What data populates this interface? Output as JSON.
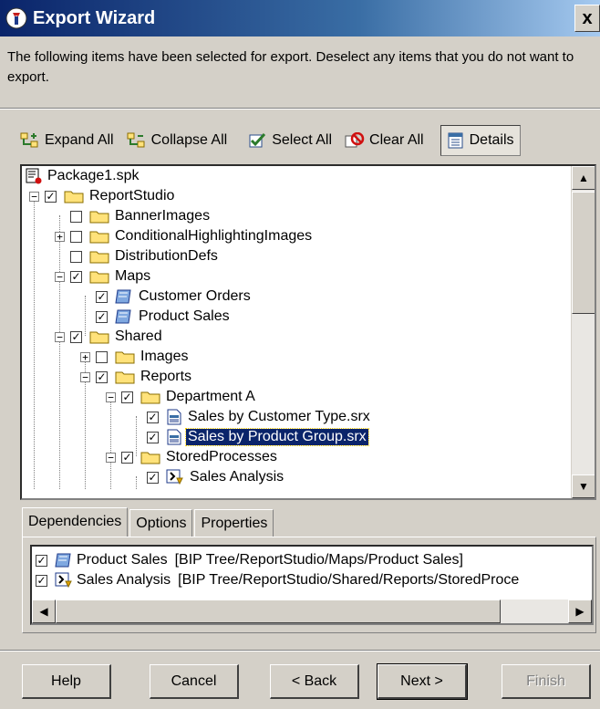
{
  "window": {
    "title": "Export Wizard",
    "close_label": "x"
  },
  "intro_text": "The following items have been selected for export.  Deselect any items that you do not want to export.",
  "toolbar": {
    "expand_all": "Expand All",
    "collapse_all": "Collapse All",
    "select_all": "Select All",
    "clear_all": "Clear All",
    "details": "Details"
  },
  "tree": {
    "root": "Package1.spk",
    "items": [
      {
        "label": "ReportStudio",
        "checked": true
      },
      {
        "label": "BannerImages",
        "checked": false
      },
      {
        "label": "ConditionalHighlightingImages",
        "checked": false
      },
      {
        "label": "DistributionDefs",
        "checked": false
      },
      {
        "label": "Maps",
        "checked": true
      },
      {
        "label": "Customer Orders",
        "checked": true
      },
      {
        "label": "Product Sales",
        "checked": true
      },
      {
        "label": "Shared",
        "checked": true
      },
      {
        "label": "Images",
        "checked": false
      },
      {
        "label": "Reports",
        "checked": true
      },
      {
        "label": "Department A",
        "checked": true
      },
      {
        "label": "Sales by Customer Type.srx",
        "checked": true
      },
      {
        "label": "Sales by Product Group.srx",
        "checked": true,
        "selected": true
      },
      {
        "label": "StoredProcesses",
        "checked": true
      },
      {
        "label": "Sales Analysis",
        "checked": true
      }
    ]
  },
  "tabs": [
    "Dependencies",
    "Options",
    "Properties"
  ],
  "dependencies": [
    {
      "name": "Product Sales",
      "path": "[BIP Tree/ReportStudio/Maps/Product Sales]",
      "checked": true
    },
    {
      "name": "Sales Analysis",
      "path": "[BIP Tree/ReportStudio/Shared/Reports/StoredProce",
      "checked": true
    }
  ],
  "buttons": {
    "help": "Help",
    "cancel": "Cancel",
    "back": "< Back",
    "next": "Next >",
    "finish": "Finish"
  },
  "colors": {
    "selection": "#0a246a",
    "title_start": "#0a246a",
    "folder": "#ffe27a"
  }
}
